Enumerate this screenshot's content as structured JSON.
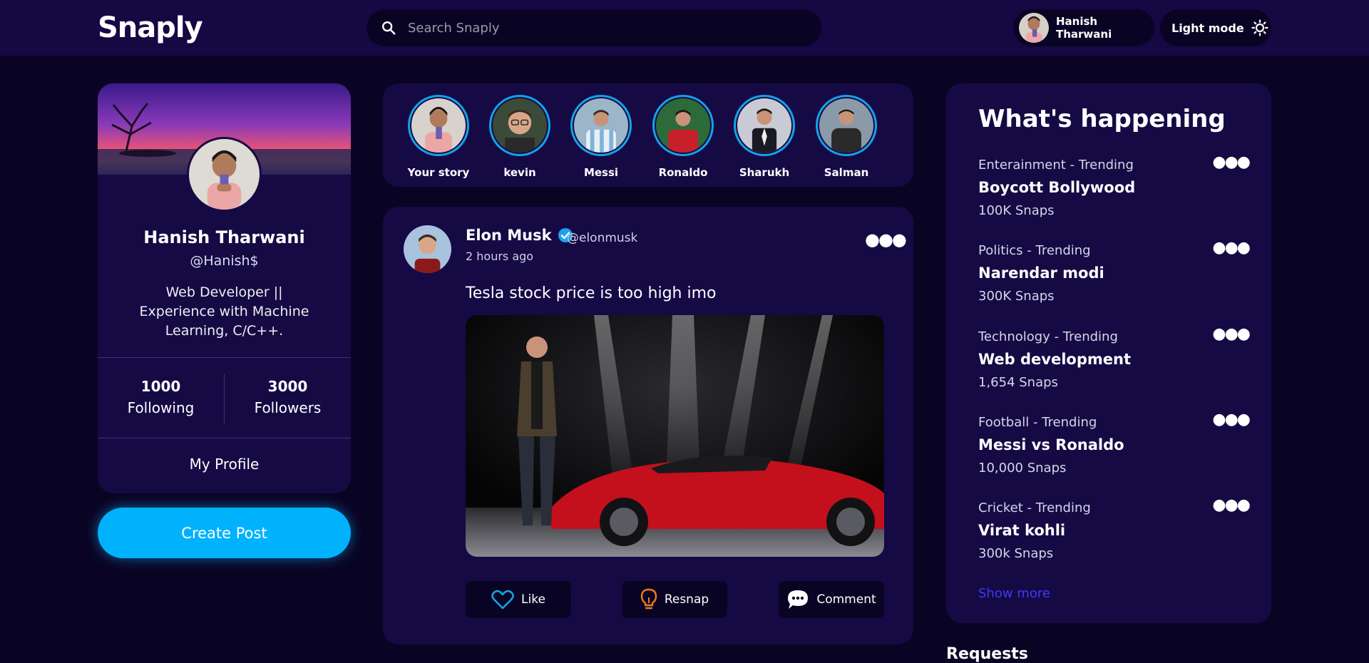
{
  "nav": {
    "logo": "Snaply",
    "search_placeholder": "Search Snaply",
    "user_name": "Hanish Tharwani",
    "mode_label": "Light mode"
  },
  "profile": {
    "name": "Hanish Tharwani",
    "handle": "@Hanish$",
    "bio": "Web Developer || Experience with Machine Learning, C/C++.",
    "following_count": "1000",
    "following_label": "Following",
    "followers_count": "3000",
    "followers_label": "Followers",
    "my_profile_label": "My Profile"
  },
  "create_post_label": "Create Post",
  "stories": [
    {
      "name": "Your story"
    },
    {
      "name": "kevin"
    },
    {
      "name": "Messi"
    },
    {
      "name": "Ronaldo"
    },
    {
      "name": "Sharukh"
    },
    {
      "name": "Salman"
    }
  ],
  "post": {
    "author": "Elon Musk",
    "handle": "@elonmusk",
    "time": "2 hours ago",
    "text": "Tesla stock price is too high imo",
    "like_label": "Like",
    "resnap_label": "Resnap",
    "comment_label": "Comment"
  },
  "trending": {
    "title": "What's happening",
    "items": [
      {
        "category": "Enterainment - Trending",
        "topic": "Boycott Bollywood",
        "count": "100K Snaps"
      },
      {
        "category": "Politics - Trending",
        "topic": "Narendar modi",
        "count": "300K Snaps"
      },
      {
        "category": "Technology - Trending",
        "topic": "Web development",
        "count": "1,654 Snaps"
      },
      {
        "category": "Football - Trending",
        "topic": "Messi vs Ronaldo",
        "count": "10,000 Snaps"
      },
      {
        "category": "Cricket - Trending",
        "topic": "Virat kohli",
        "count": "300k Snaps"
      }
    ],
    "show_more": "Show more"
  },
  "requests_title": "Requests",
  "colors": {
    "background": "#0a0424",
    "nav": "#150843",
    "card": "#160a45",
    "accent": "#00b2fc",
    "story_ring": "#12a3e6",
    "link": "#3a3af5"
  }
}
